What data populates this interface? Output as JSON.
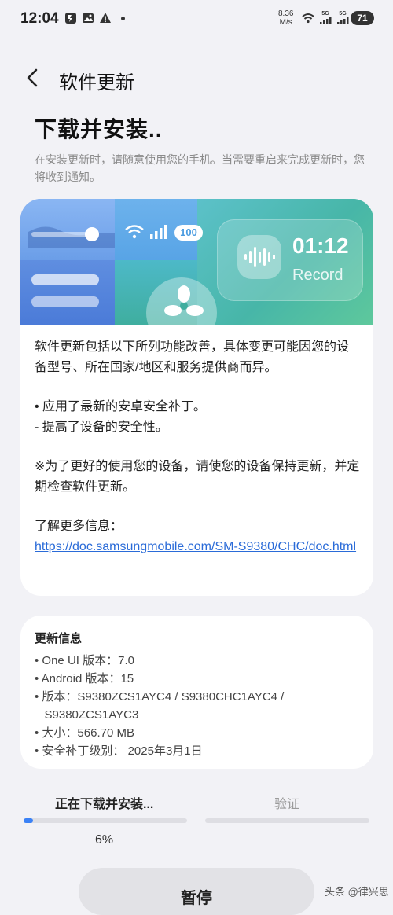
{
  "status_bar": {
    "time": "12:04",
    "net_speed_value": "8.36",
    "net_speed_unit": "M/s",
    "battery": "71",
    "signal_labels": [
      "5G",
      "5G"
    ]
  },
  "header": {
    "title": "软件更新",
    "back_icon": "chevron-left-icon"
  },
  "heading": "下载并安装..",
  "subtext": "在安装更新时，请随意使用您的手机。当需要重启来完成更新时，您将收到通知。",
  "banner": {
    "pill_text": "100",
    "record_time": "01:12",
    "record_label": "Record"
  },
  "description": {
    "intro": "软件更新包括以下所列功能改善，具体变更可能因您的设备型号、所在国家/地区和服务提供商而异。",
    "bullet1": "• 应用了最新的安卓安全补丁。",
    "bullet1_sub": " - 提高了设备的安全性。",
    "note": "※为了更好的使用您的设备，请使您的设备保持更新，并定期检查软件更新。",
    "more_info_label": "了解更多信息：",
    "link": "https://doc.samsungmobile.com/SM-S9380/CHC/doc.html"
  },
  "update_info": {
    "title": "更新信息",
    "items": [
      "• One UI 版本：7.0",
      "• Android 版本：15",
      "• 版本：S9380ZCS1AYC4 / S9380CHC1AYC4 /",
      "   S9380ZCS1AYC3",
      "• 大小：566.70 MB",
      "• 安全补丁级别： 2025年3月1日"
    ]
  },
  "progress": {
    "step1_label": "正在下载并安装...",
    "step2_label": "验证",
    "percent_text": "6%",
    "fraction": 0.06
  },
  "pause_button": "暂停",
  "watermark": "头条 @律兴思",
  "colors": {
    "accent": "#3b82f6",
    "link": "#2a6bd8",
    "background": "#f2f2f6"
  }
}
